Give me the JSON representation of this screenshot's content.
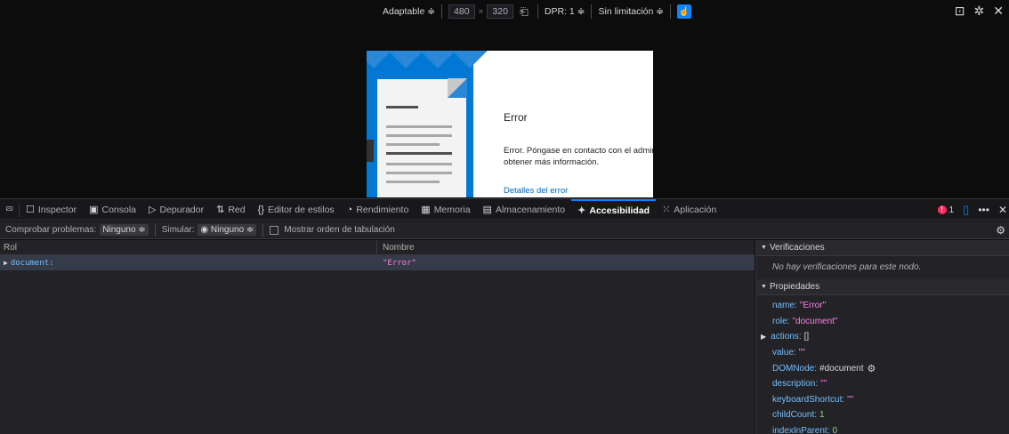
{
  "rdm": {
    "device": "Adaptable ≑",
    "width": "480",
    "times": "×",
    "height": "320",
    "dpr": "DPR: 1  ≑",
    "throttle": "Sin limitación ≑",
    "icons": [
      "rotate-icon",
      "touch-icon",
      "screenshot-icon",
      "settings-icon",
      "close-icon"
    ]
  },
  "page": {
    "title": "Error",
    "message": "Error. Póngase en contacto con el admini\nobtener más información.",
    "link": "Detalles del error"
  },
  "tabs": [
    {
      "icon": "☐",
      "label": "Inspector"
    },
    {
      "icon": "▣",
      "label": "Consola"
    },
    {
      "icon": "▷",
      "label": "Depurador"
    },
    {
      "icon": "⇅",
      "label": "Red"
    },
    {
      "icon": "{}",
      "label": "Editor de estilos"
    },
    {
      "icon": "◔",
      "label": "Rendimiento"
    },
    {
      "icon": "▦",
      "label": "Memoria"
    },
    {
      "icon": "▤",
      "label": "Almacenamiento"
    },
    {
      "icon": "✦",
      "label": "Accesibilidad"
    },
    {
      "icon": "⁙",
      "label": "Aplicación"
    }
  ],
  "active_tab": "Accesibilidad",
  "error_count": "1",
  "a11y_toolbar": {
    "check_label": "Comprobar problemas:",
    "check_value": "Ninguno ≑",
    "simulate_label": "Simular:",
    "simulate_value": "◉ Ninguno ≑",
    "tab_order_label": "Mostrar orden de tabulación"
  },
  "tree": {
    "col_role": "Rol",
    "col_name": "Nombre",
    "rows": [
      {
        "role": "document:",
        "name": "\"Error\""
      }
    ]
  },
  "side": {
    "checks_header": "Verificaciones",
    "no_checks": "No hay verificaciones para este nodo.",
    "props_header": "Propiedades",
    "props": [
      {
        "key": "name:",
        "value": "\"Error\"",
        "type": "str"
      },
      {
        "key": "role:",
        "value": "\"document\"",
        "type": "str"
      },
      {
        "key": "actions:",
        "value": "[]",
        "type": "node",
        "expandable": true
      },
      {
        "key": "value:",
        "value": "\"\"",
        "type": "str"
      },
      {
        "key": "DOMNode:",
        "value": "#document",
        "type": "node",
        "gear": true
      },
      {
        "key": "description:",
        "value": "\"\"",
        "type": "str"
      },
      {
        "key": "keyboardShortcut:",
        "value": "\"\"",
        "type": "str"
      },
      {
        "key": "childCount:",
        "value": "1",
        "type": "num"
      },
      {
        "key": "indexInParent:",
        "value": "0",
        "type": "num"
      }
    ]
  }
}
